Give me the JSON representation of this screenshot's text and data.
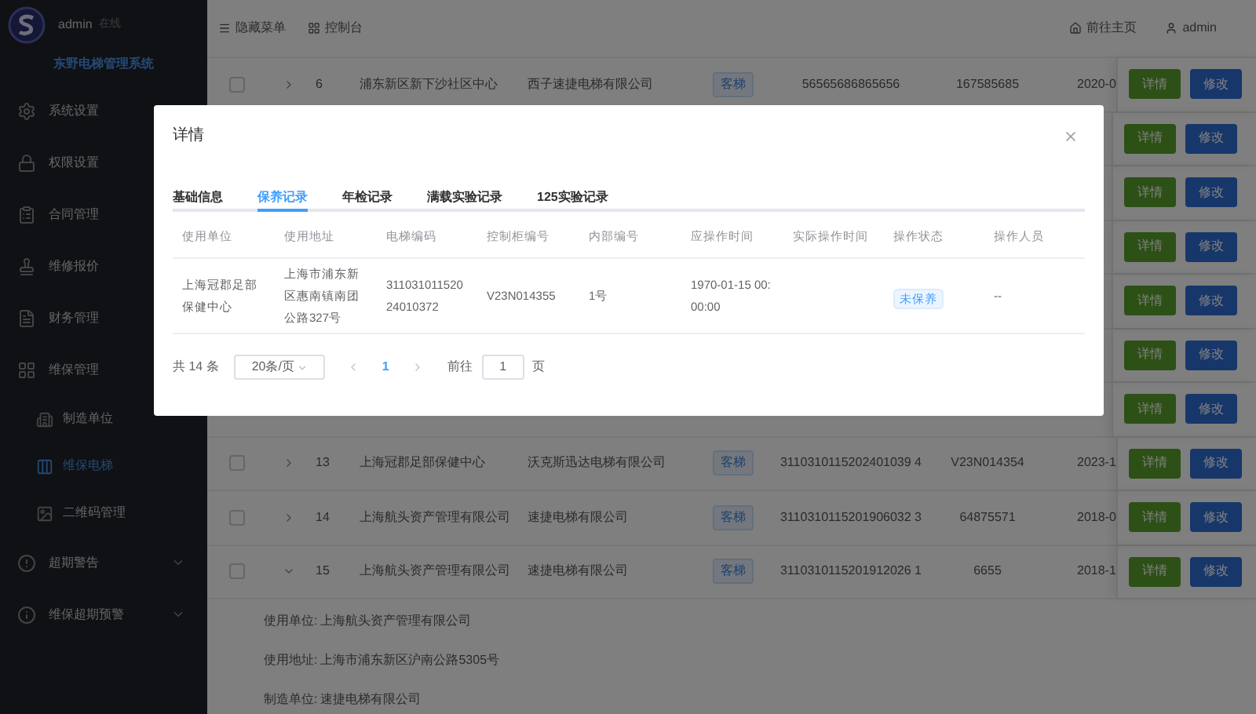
{
  "sidebar": {
    "user": "admin",
    "status": "在线",
    "system_name": "东野电梯管理系统",
    "items": [
      {
        "label": "系统设置",
        "selected": false
      },
      {
        "label": "权限设置",
        "selected": false
      },
      {
        "label": "合同管理",
        "selected": false
      },
      {
        "label": "维修报价",
        "selected": false
      },
      {
        "label": "财务管理",
        "selected": false
      },
      {
        "label": "维保管理",
        "selected": false,
        "children": [
          {
            "label": "制造单位",
            "selected": false
          },
          {
            "label": "维保电梯",
            "selected": true
          },
          {
            "label": "二维码管理",
            "selected": false
          }
        ]
      },
      {
        "label": "超期警告",
        "selected": false,
        "expanded": false
      },
      {
        "label": "维保超期预警",
        "selected": false,
        "expanded": false
      }
    ]
  },
  "topbar": {
    "left": [
      "隐藏菜单",
      "控制台"
    ],
    "right": [
      "前往主页",
      "admin"
    ]
  },
  "table": {
    "rows": [
      {
        "kind": "full",
        "checked": false,
        "expanded": false,
        "index": "6",
        "unit": "浦东新区新下沙社区中心",
        "maker": "西子速捷电梯有限公司",
        "tag": "客梯",
        "code": "56565686865656",
        "cabinet": "167585685",
        "date": "2020-0",
        "actions": [
          "详情",
          "修改"
        ]
      },
      {
        "kind": "hidden",
        "actions": [
          "详情",
          "修改"
        ]
      },
      {
        "kind": "hidden",
        "actions": [
          "详情",
          "修改"
        ]
      },
      {
        "kind": "hidden",
        "actions": [
          "详情",
          "修改"
        ]
      },
      {
        "kind": "hidden",
        "actions": [
          "详情",
          "修改"
        ]
      },
      {
        "kind": "hidden",
        "actions": [
          "详情",
          "修改"
        ]
      },
      {
        "kind": "hidden",
        "actions": [
          "详情",
          "修改"
        ]
      },
      {
        "kind": "full",
        "checked": false,
        "expanded": false,
        "index": "13",
        "unit": "上海冠郡足部保健中心",
        "maker": "沃克斯迅达电梯有限公司",
        "tag": "客梯",
        "code": "3110310115202401039 4",
        "cabinet": "V23N014354",
        "date": "2023-1",
        "actions": [
          "详情",
          "修改"
        ]
      },
      {
        "kind": "full",
        "checked": false,
        "expanded": false,
        "index": "14",
        "unit": "上海航头资产管理有限公司",
        "maker": "速捷电梯有限公司",
        "tag": "客梯",
        "code": "3110310115201906032 3",
        "cabinet": "64875571",
        "date": "2018-0",
        "actions": [
          "详情",
          "修改"
        ]
      },
      {
        "kind": "full",
        "checked": false,
        "expanded": true,
        "index": "15",
        "unit": "上海航头资产管理有限公司",
        "maker": "速捷电梯有限公司",
        "tag": "客梯",
        "code": "3110310115201912026 1",
        "cabinet": "6655",
        "date": "2018-1",
        "actions": [
          "详情",
          "修改"
        ]
      }
    ],
    "expanded_details": [
      {
        "label": "使用单位:",
        "value": "上海航头资产管理有限公司"
      },
      {
        "label": "使用地址:",
        "value": "上海市浦东新区沪南公路5305号"
      },
      {
        "label": "制造单位:",
        "value": "速捷电梯有限公司"
      }
    ]
  },
  "dialog": {
    "title": "详情",
    "tabs": [
      {
        "label": "基础信息",
        "selected": false
      },
      {
        "label": "保养记录",
        "selected": true
      },
      {
        "label": "年检记录",
        "selected": false
      },
      {
        "label": "满载实验记录",
        "selected": false
      },
      {
        "label": "125实验记录",
        "selected": false
      }
    ],
    "columns": [
      "使用单位",
      "使用地址",
      "电梯编码",
      "控制柜编号",
      "内部编号",
      "应操作时间",
      "实际操作时间",
      "操作状态",
      "操作人员"
    ],
    "rows": [
      {
        "cells": [
          "上海冠郡足部保健中心",
          "上海市浦东新区惠南镇南团公路327号",
          "31103101152024010372",
          "V23N014355",
          "1号",
          "1970-01-15 00:00:00",
          "",
          "未保养",
          "--"
        ]
      }
    ],
    "pagination": {
      "total": "共 14 条",
      "page_size": "20条/页",
      "pages": [
        {
          "label": "1",
          "selected": true
        }
      ],
      "goto_label": "前往",
      "goto_value": "1",
      "goto_suffix": "页"
    }
  }
}
